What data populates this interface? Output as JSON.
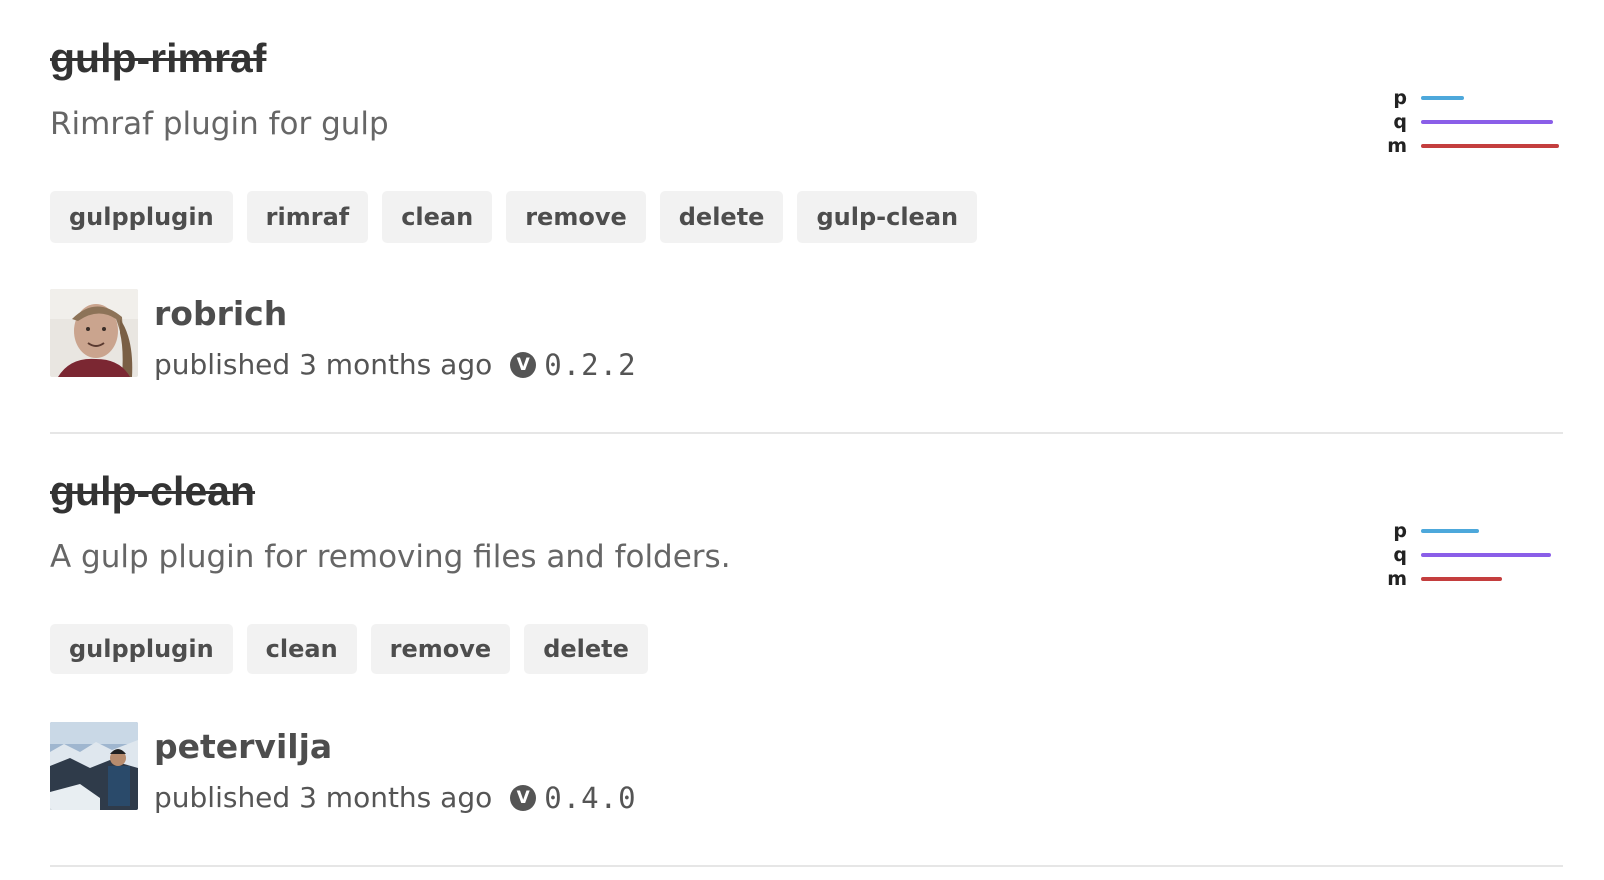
{
  "results": [
    {
      "name": "gulp-rimraf",
      "description": "Rimraf plugin for gulp",
      "keywords": [
        "gulpplugin",
        "rimraf",
        "clean",
        "remove",
        "delete",
        "gulp-clean"
      ],
      "publisher": "robrich",
      "published": "published 3 months ago",
      "version_badge": "V",
      "version": "0.2.2",
      "scores": {
        "labels": [
          "p",
          "q",
          "m"
        ],
        "values": [
          0.31,
          0.96,
          1.0
        ]
      }
    },
    {
      "name": "gulp-clean",
      "description": "A gulp plugin for removing files and folders.",
      "keywords": [
        "gulpplugin",
        "clean",
        "remove",
        "delete"
      ],
      "publisher": "petervilja",
      "published": "published 3 months ago",
      "version_badge": "V",
      "version": "0.4.0",
      "scores": {
        "labels": [
          "p",
          "q",
          "m"
        ],
        "values": [
          0.42,
          0.94,
          0.59
        ]
      }
    }
  ],
  "colors": {
    "popularity": "#4da8db",
    "quality": "#8a5ee8",
    "maintenance": "#c43e3e"
  }
}
